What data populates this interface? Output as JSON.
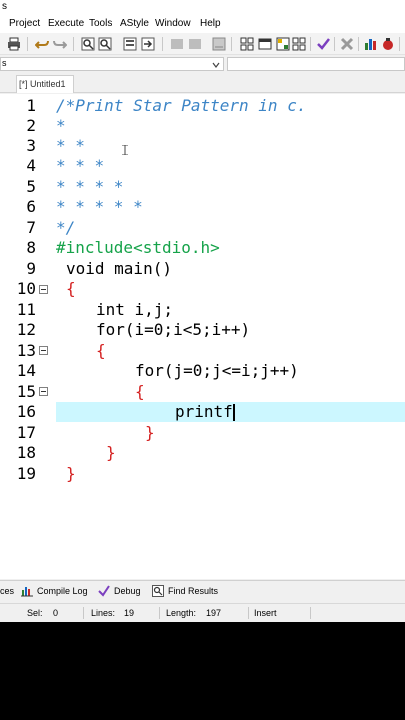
{
  "window": {
    "title_fragment": "s"
  },
  "menu": [
    "Project",
    "Execute",
    "Tools",
    "AStyle",
    "Window",
    "Help"
  ],
  "combobar": {
    "value": "s"
  },
  "tab": {
    "label": "[*] Untitled1"
  },
  "editor": {
    "line_numbers": [
      "1",
      "2",
      "3",
      "4",
      "5",
      "6",
      "7",
      "8",
      "9",
      "10",
      "11",
      "12",
      "13",
      "14",
      "15",
      "16",
      "17",
      "18",
      "19"
    ],
    "lines": {
      "l1": "/*Print Star Pattern in c.",
      "l2": "*",
      "l3": "* *",
      "l4": "* * *",
      "l5": "* * * *",
      "l6": "* * * * *",
      "l7": "*/",
      "l8": "#include<stdio.h>",
      "l9": "void main()",
      "l10": "{",
      "l11": "int i,j;",
      "l12": "for(i=0;i<5;i++)",
      "l13": "{",
      "l14": "for(j=0;j<=i;j++)",
      "l15": "{",
      "l16": "printf",
      "l17": "}",
      "l18": "}",
      "l19": "}"
    },
    "current_line": 16,
    "colors": {
      "comment": "#3d85c6",
      "preprocessor": "#16a34a",
      "brace": "#d42020",
      "current_line_bg": "#ccf7ff"
    }
  },
  "bottom_tabs": {
    "resources": "ces",
    "compile_log": "Compile Log",
    "debug": "Debug",
    "find_results": "Find Results"
  },
  "status": {
    "sel_label": "Sel:",
    "sel_value": "0",
    "lines_label": "Lines:",
    "lines_value": "19",
    "length_label": "Length:",
    "length_value": "197",
    "mode": "Insert"
  }
}
